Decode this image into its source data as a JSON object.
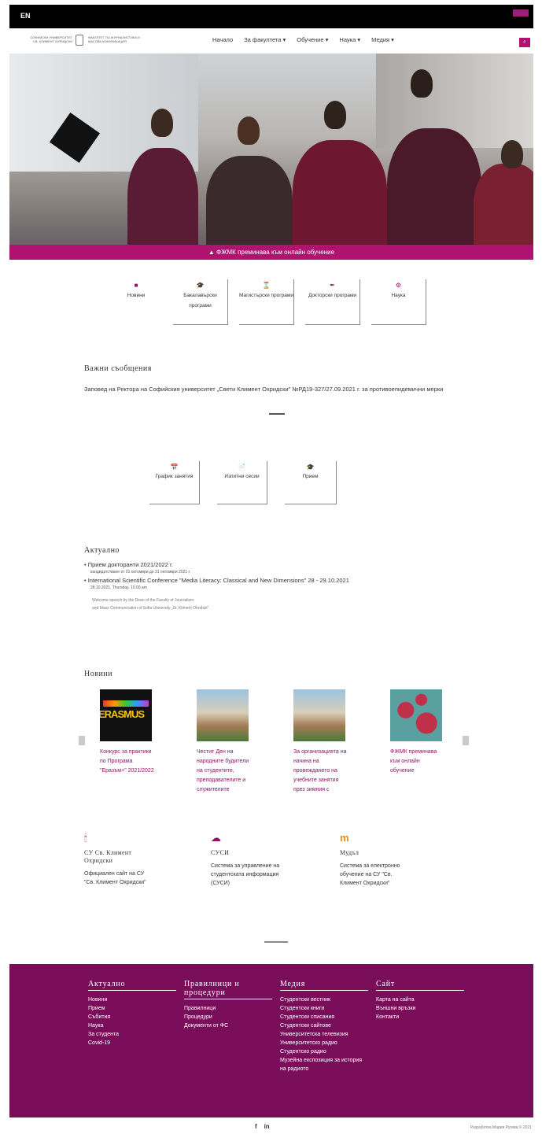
{
  "topbar": {
    "lang": "EN"
  },
  "header": {
    "logo_left": "СОФИЙСКИ УНИВЕРСИТЕТ СВ. КЛИМЕНТ ОХРИДСКИ",
    "logo_right": "ФАКУЛТЕТ ПО ЖУРНАЛИСТИКА И МАСОВА КОМУНИКАЦИЯ",
    "nav": [
      "Начало",
      "За факултета ▾",
      "Обучение ▾",
      "Наука ▾",
      "Медия ▾"
    ]
  },
  "banner": "▲ ФЖМК преминава към онлайн обучение",
  "quick_links": [
    {
      "icon": "■",
      "label": "Новини"
    },
    {
      "icon": "🎓",
      "label": "Бакалавърски програми"
    },
    {
      "icon": "⌛",
      "label": "Магистърски програми"
    },
    {
      "icon": "✒",
      "label": "Докторски програми"
    },
    {
      "icon": "⚙",
      "label": "Наука"
    }
  ],
  "important": {
    "title": "Важни съобщения",
    "text": "Заповед на Ректора на Софийския университет „Свети Климент Охридски\" №РД19-327/27.09.2021 г. за противоепидемични мерки"
  },
  "quick_links2": [
    {
      "icon": "📅",
      "label": "График занятия"
    },
    {
      "icon": "📄",
      "label": "Изпитни сесии"
    },
    {
      "icon": "🎓",
      "label": "Прием"
    }
  ],
  "actual": {
    "title": "Актуално",
    "items": [
      {
        "title": "Прием докторанти 2021/2022 г.",
        "sub": "кандидатстване от 01 октомври до 31 октомври 2021 г."
      },
      {
        "title": "International Scientific Conference \"Media Literacy: Classical and New Dimensions\" 28 - 29.10.2021",
        "sub": "28.10.2021, Thursday, 10.00 am",
        "desc1": "Welcome speech by the Dean of the Faculty of Journalism",
        "desc2": "and Mass Communication of Sofia University „St. Kliment Ohridski\""
      }
    ]
  },
  "news": {
    "title": "Новини",
    "items": [
      {
        "caption": "Конкурс за практики по Програма \"Еразъм+\" 2021/2022",
        "thumb_text": "ERASMUS"
      },
      {
        "caption": "Честит Ден на народните будители на студентите, преподавателите и служителите"
      },
      {
        "caption": "За организацията на начина на провеждането на учебните занятия през зимния с"
      },
      {
        "caption": "ФЖМК преминава към онлайн обучение"
      }
    ]
  },
  "external_links": [
    {
      "icon": "🕯",
      "title": "СУ Св. Климент Охридски",
      "desc": "Официален сайт на СУ \"Св. Климент Охридски\""
    },
    {
      "icon": "☁",
      "title": "СУСИ",
      "desc": "Система за управление на студентската информация (СУСИ)"
    },
    {
      "icon": "m",
      "title": "Мудъл",
      "desc": "Система за електронно обучение на СУ \"Св. Климент Охридски\""
    }
  ],
  "footer": {
    "columns": [
      {
        "title": "Актуално",
        "items": [
          "Новини",
          "Прием",
          "Събития",
          "Наука",
          "За студента",
          "Covid-19"
        ]
      },
      {
        "title": "Правилници и процедури",
        "items": [
          "Правилници",
          "Процедури",
          "Документи от ФС"
        ]
      },
      {
        "title": "Медия",
        "items": [
          "Студентски вестник",
          "Студентски книги",
          "Студентски списания",
          "Студентски сайтове",
          "Университетска телевизия",
          "Университетско радио",
          "Студентско радио",
          "Музейна експозиция за история на радиото"
        ]
      },
      {
        "title": "Сайт",
        "items": [
          "Карта на сайта",
          "Външни връзки",
          "Контакти"
        ]
      }
    ]
  },
  "bottom": {
    "social_f": "f",
    "social_in": "in",
    "copyright": "Разработка Мария Ругева © 2021"
  },
  "colors": {
    "accent": "#b0126f",
    "footer": "#7a0d5a"
  }
}
